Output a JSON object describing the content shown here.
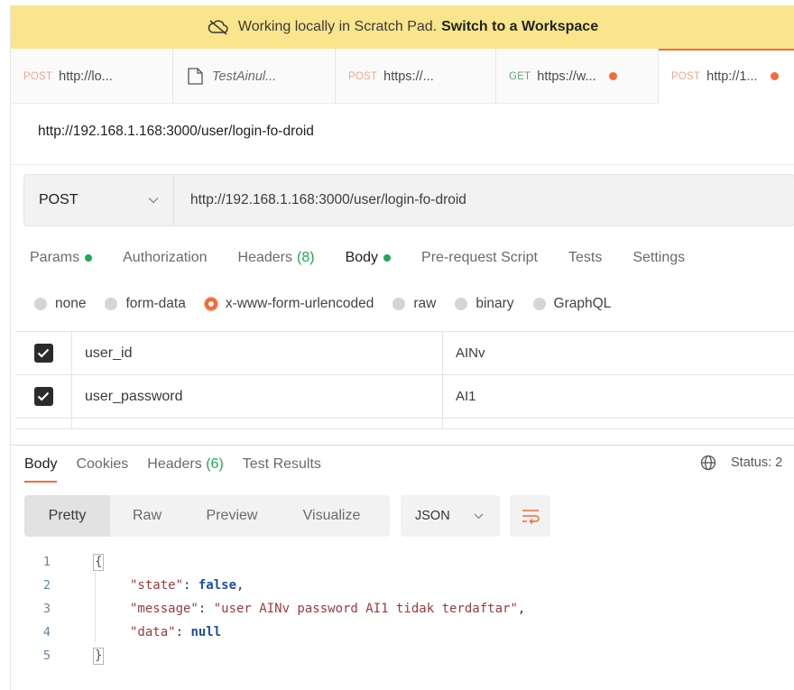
{
  "banner": {
    "text": "Working locally in Scratch Pad.",
    "link": "Switch to a Workspace"
  },
  "tabs": [
    {
      "method": "POST",
      "label": "http://lo..."
    },
    {
      "method": "",
      "label": "TestAinul..."
    },
    {
      "method": "POST",
      "label": "https://..."
    },
    {
      "method": "GET",
      "label": "https://w..."
    },
    {
      "method": "POST",
      "label": "http://1..."
    }
  ],
  "request": {
    "name": "http://192.168.1.168:3000/user/login-fo-droid",
    "method": "POST",
    "url": "http://192.168.1.168:3000/user/login-fo-droid"
  },
  "request_tabs": {
    "params": "Params",
    "authorization": "Authorization",
    "headers": "Headers",
    "headers_count": "(8)",
    "body": "Body",
    "prerequest": "Pre-request Script",
    "tests": "Tests",
    "settings": "Settings"
  },
  "body_types": {
    "none": "none",
    "form_data": "form-data",
    "urlencoded": "x-www-form-urlencoded",
    "raw": "raw",
    "binary": "binary",
    "graphql": "GraphQL"
  },
  "form_rows": [
    {
      "key": "user_id",
      "value": "AINv"
    },
    {
      "key": "user_password",
      "value": "AI1"
    }
  ],
  "response_tabs": {
    "body": "Body",
    "cookies": "Cookies",
    "headers": "Headers",
    "headers_count": "(6)",
    "test_results": "Test Results",
    "status": "Status: 2"
  },
  "view_modes": {
    "pretty": "Pretty",
    "raw": "Raw",
    "preview": "Preview",
    "visualize": "Visualize",
    "format": "JSON"
  },
  "code": {
    "line_numbers": [
      "1",
      "2",
      "3",
      "4",
      "5"
    ],
    "open": "{",
    "close": "}",
    "k_state": "\"state\"",
    "v_state": "false",
    "k_message": "\"message\"",
    "v_message": "\"user AINv password AI1 tidak terdaftar\"",
    "k_data": "\"data\"",
    "v_data": "null",
    "colon": ": ",
    "comma": ","
  }
}
